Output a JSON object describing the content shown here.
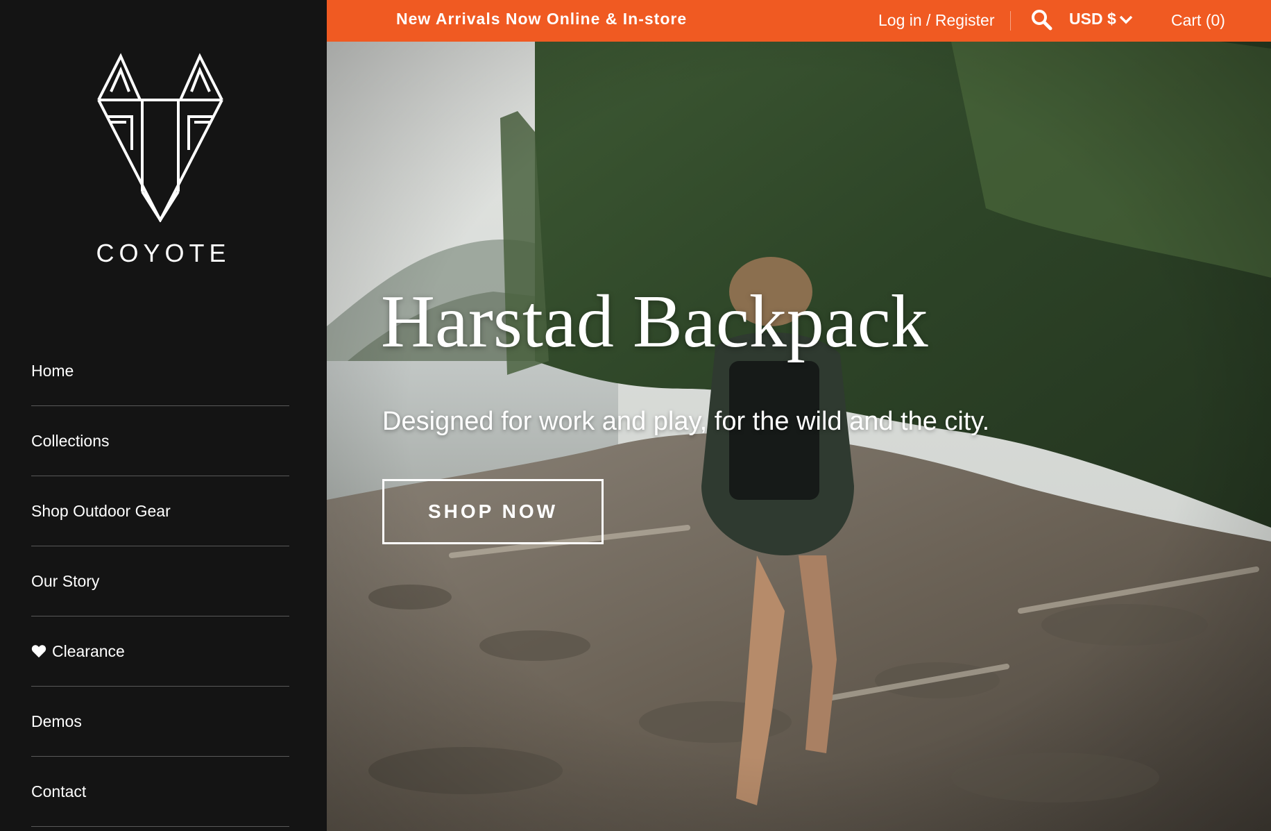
{
  "brand": {
    "name": "COYOTE",
    "logo_icon": "fox-head-logo"
  },
  "sidebar": {
    "items": [
      {
        "label": "Home"
      },
      {
        "label": "Collections"
      },
      {
        "label": "Shop Outdoor Gear"
      },
      {
        "label": "Our Story"
      },
      {
        "label": "Clearance",
        "icon": "heart-icon"
      },
      {
        "label": "Demos"
      },
      {
        "label": "Contact"
      }
    ]
  },
  "topbar": {
    "announcement": "New Arrivals Now Online & In-store",
    "login_label": "Log in / Register",
    "search_icon": "search-icon",
    "currency": "USD $",
    "cart_label": "Cart (0)",
    "background": "#f05a22"
  },
  "hero": {
    "title": "Harstad Backpack",
    "subtitle": "Designed for work and play, for the wild and the city.",
    "cta_label": "SHOP NOW"
  },
  "colors": {
    "sidebar_bg": "#141414",
    "accent": "#f05a22",
    "text": "#ffffff"
  }
}
